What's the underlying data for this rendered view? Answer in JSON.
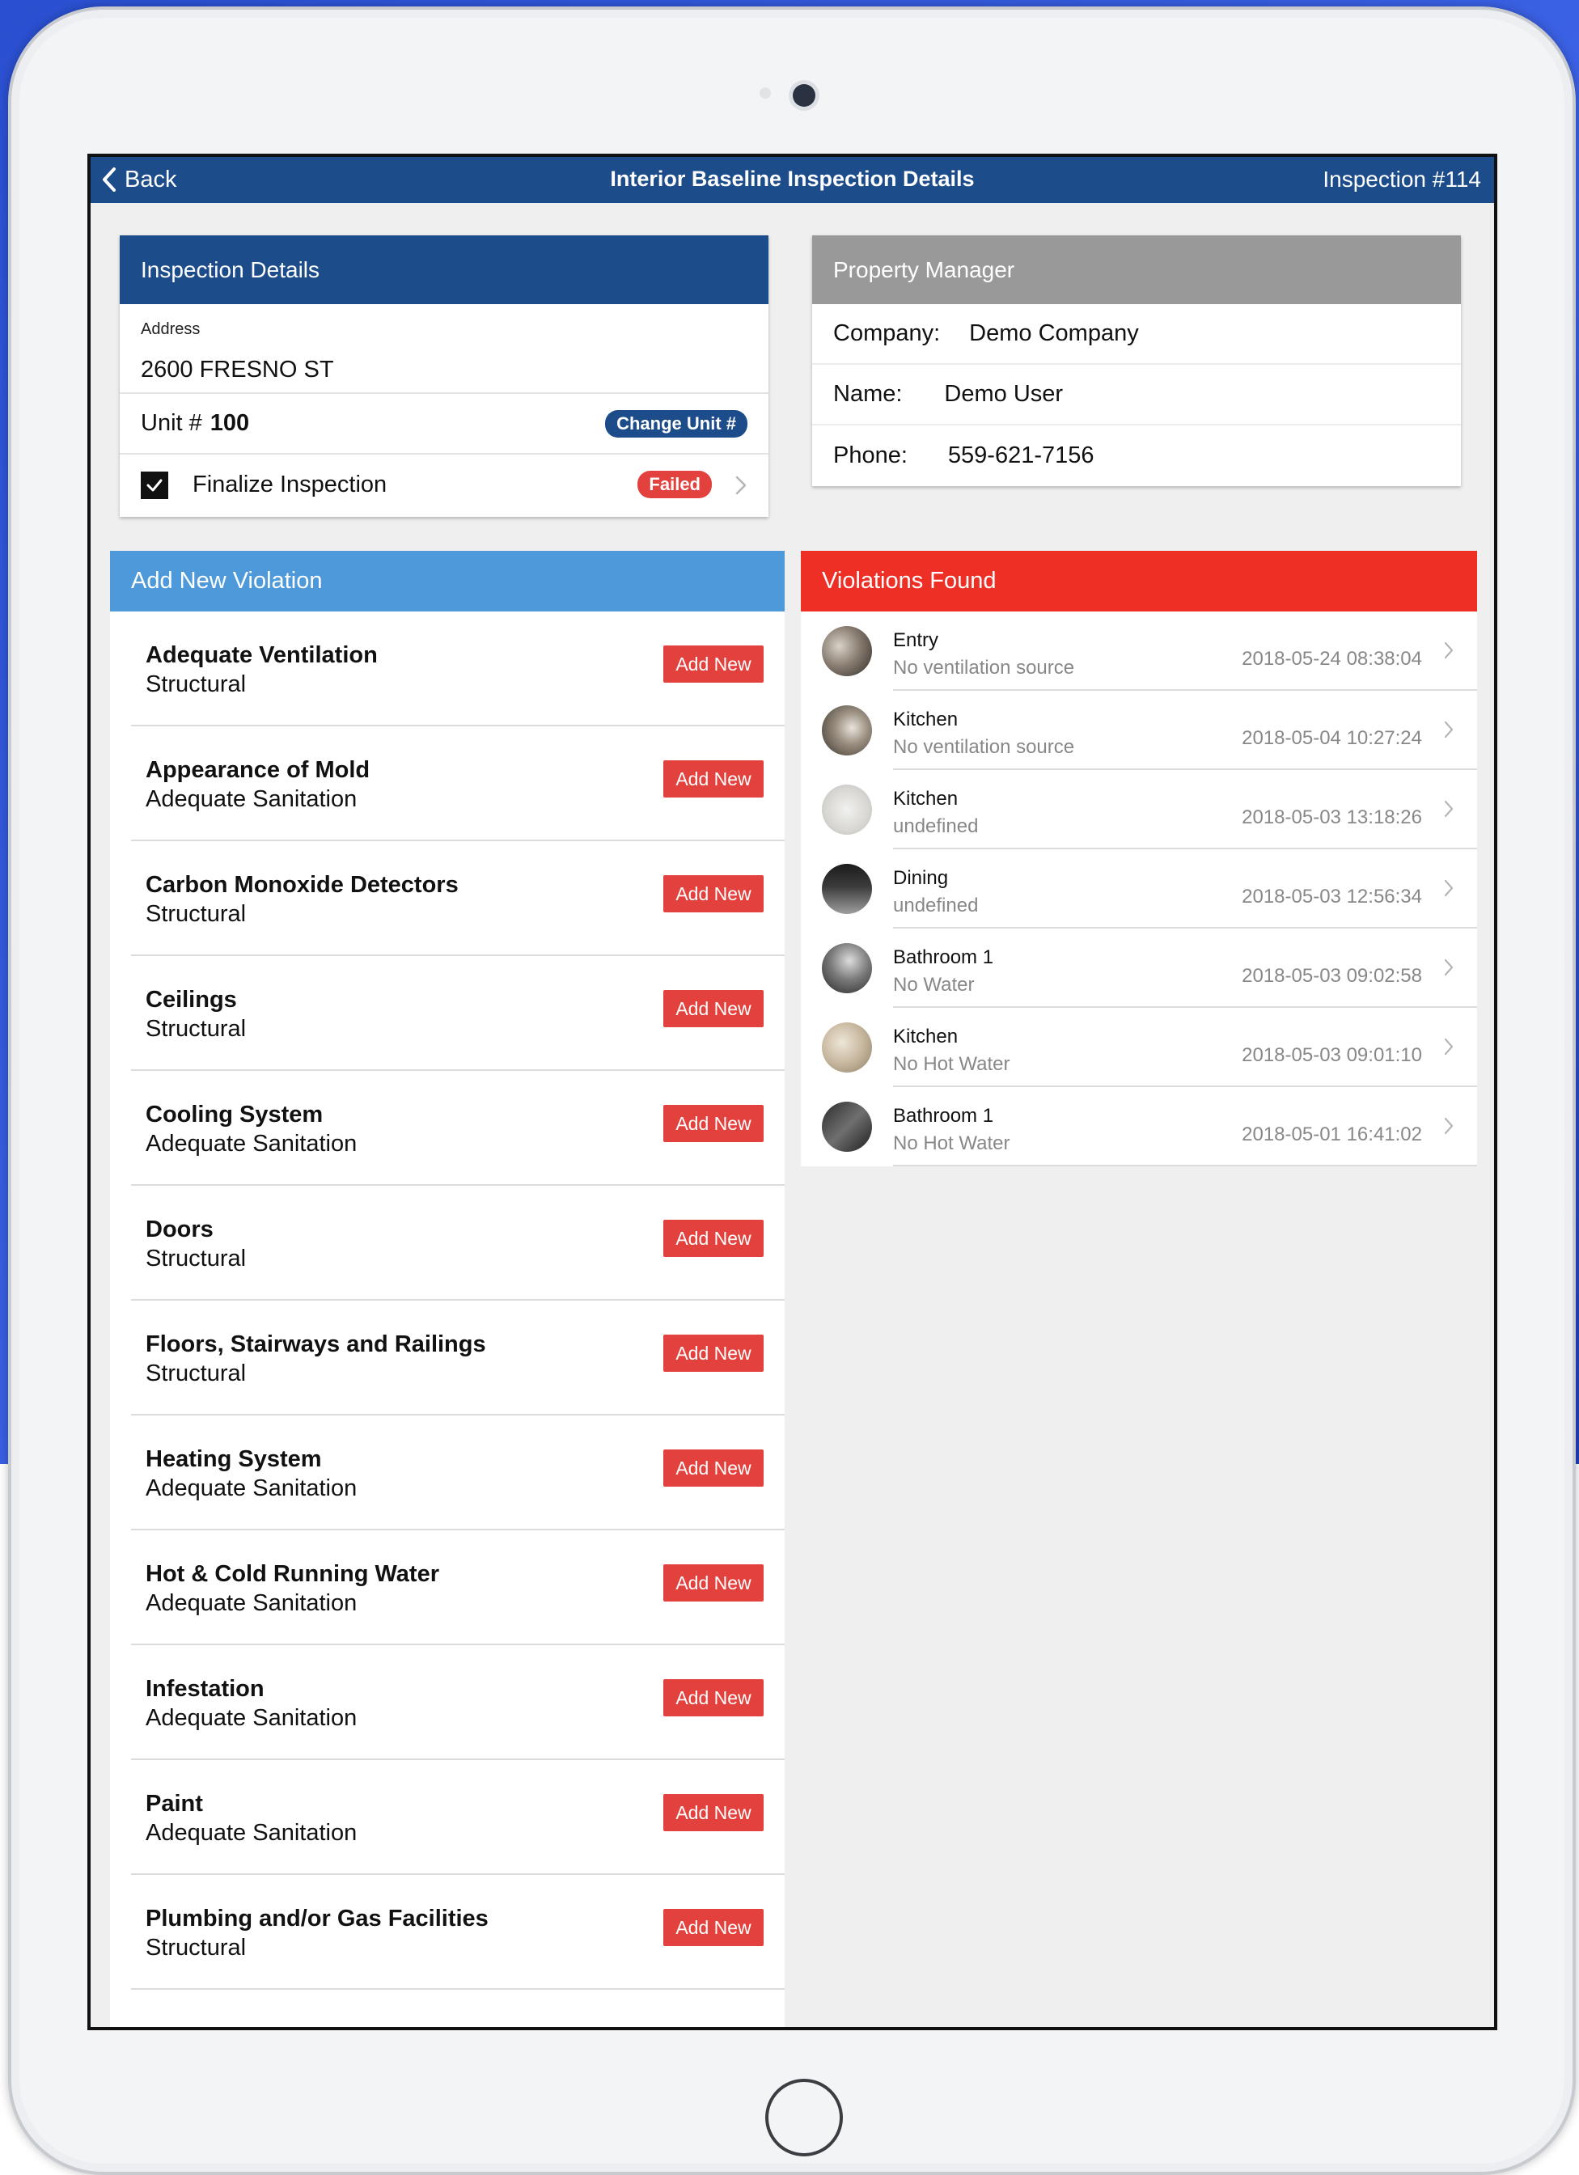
{
  "nav": {
    "back_label": "Back",
    "title": "Interior Baseline Inspection Details",
    "inspection_label": "Inspection #114"
  },
  "details": {
    "header": "Inspection Details",
    "address_label": "Address",
    "address_value": "2600 FRESNO ST",
    "unit_label": "Unit #",
    "unit_number": "100",
    "change_unit_label": "Change Unit #",
    "finalize_label": "Finalize Inspection",
    "finalize_checked": true,
    "status_badge": "Failed"
  },
  "property_manager": {
    "header": "Property Manager",
    "rows": [
      {
        "key": "Company:",
        "value": "Demo Company"
      },
      {
        "key": "Name:",
        "value": "Demo User"
      },
      {
        "key": "Phone:",
        "value": "559-621-7156"
      }
    ]
  },
  "add_violation": {
    "header": "Add New Violation",
    "button_label": "Add New",
    "items": [
      {
        "name": "Adequate Ventilation",
        "category": "Structural"
      },
      {
        "name": "Appearance of Mold",
        "category": "Adequate Sanitation"
      },
      {
        "name": "Carbon Monoxide Detectors",
        "category": "Structural"
      },
      {
        "name": "Ceilings",
        "category": "Structural"
      },
      {
        "name": "Cooling System",
        "category": "Adequate Sanitation"
      },
      {
        "name": "Doors",
        "category": "Structural"
      },
      {
        "name": "Floors, Stairways and Railings",
        "category": "Structural"
      },
      {
        "name": "Heating System",
        "category": "Adequate Sanitation"
      },
      {
        "name": "Hot & Cold Running Water",
        "category": "Adequate Sanitation"
      },
      {
        "name": "Infestation",
        "category": "Adequate Sanitation"
      },
      {
        "name": "Paint",
        "category": "Adequate Sanitation"
      },
      {
        "name": "Plumbing and/or Gas Facilities",
        "category": "Structural"
      }
    ]
  },
  "violations_found": {
    "header": "Violations Found",
    "items": [
      {
        "room": "Entry",
        "description": "No ventilation source",
        "timestamp": "2018-05-24 08:38:04"
      },
      {
        "room": "Kitchen",
        "description": "No ventilation source",
        "timestamp": "2018-05-04 10:27:24"
      },
      {
        "room": "Kitchen",
        "description": "undefined",
        "timestamp": "2018-05-03 13:18:26"
      },
      {
        "room": "Dining",
        "description": "undefined",
        "timestamp": "2018-05-03 12:56:34"
      },
      {
        "room": "Bathroom 1",
        "description": "No Water",
        "timestamp": "2018-05-03 09:02:58"
      },
      {
        "room": "Kitchen",
        "description": "No Hot Water",
        "timestamp": "2018-05-03 09:01:10"
      },
      {
        "room": "Bathroom 1",
        "description": "No Hot Water",
        "timestamp": "2018-05-01 16:41:02"
      }
    ]
  },
  "colors": {
    "nav_blue": "#1d4c8a",
    "add_header_blue": "#4d99d9",
    "found_header_red": "#ee2f25",
    "button_red": "#e3413d",
    "pm_header_gray": "#999999"
  }
}
